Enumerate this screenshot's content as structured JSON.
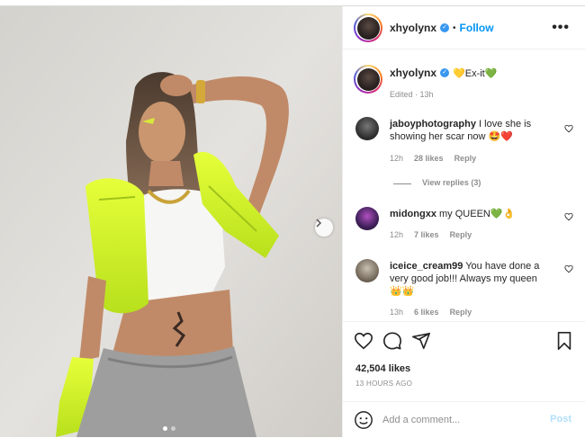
{
  "post": {
    "username": "xhyolynx",
    "follow_label": "Follow",
    "header_separator": "•",
    "more_label": "•••",
    "caption_username": "xhyolynx",
    "caption_text": "💛Ex-it💚",
    "caption_edited": "Edited · 13h"
  },
  "comments": [
    {
      "username": "jaboyphotography",
      "text": "I love she is showing her scar now 🤩❤️",
      "time": "12h",
      "likes": "28 likes",
      "reply_label": "Reply",
      "view_replies": "View replies (3)"
    },
    {
      "username": "midongxx",
      "text": "my QUEEN💚👌",
      "time": "12h",
      "likes": "7 likes",
      "reply_label": "Reply"
    },
    {
      "username": "iceice_cream99",
      "text": "You have done a very good job!!! Always my queen 👑👑",
      "time": "13h",
      "likes": "6 likes",
      "reply_label": "Reply"
    }
  ],
  "stats": {
    "likes": "42,504 likes",
    "posted": "13 HOURS AGO"
  },
  "compose": {
    "placeholder": "Add a comment...",
    "post_label": "Post"
  },
  "carousel": {
    "slide_count": 2,
    "active_index": 0
  },
  "colors": {
    "accent": "#0095f6",
    "verified": "#3897f0",
    "post_disabled": "#b2dffc",
    "like_red": "#ed4956"
  },
  "icons": [
    "verified-icon",
    "more-options-icon",
    "heart-icon",
    "comment-icon",
    "share-icon",
    "bookmark-icon",
    "emoji-icon",
    "next-arrow-icon"
  ]
}
